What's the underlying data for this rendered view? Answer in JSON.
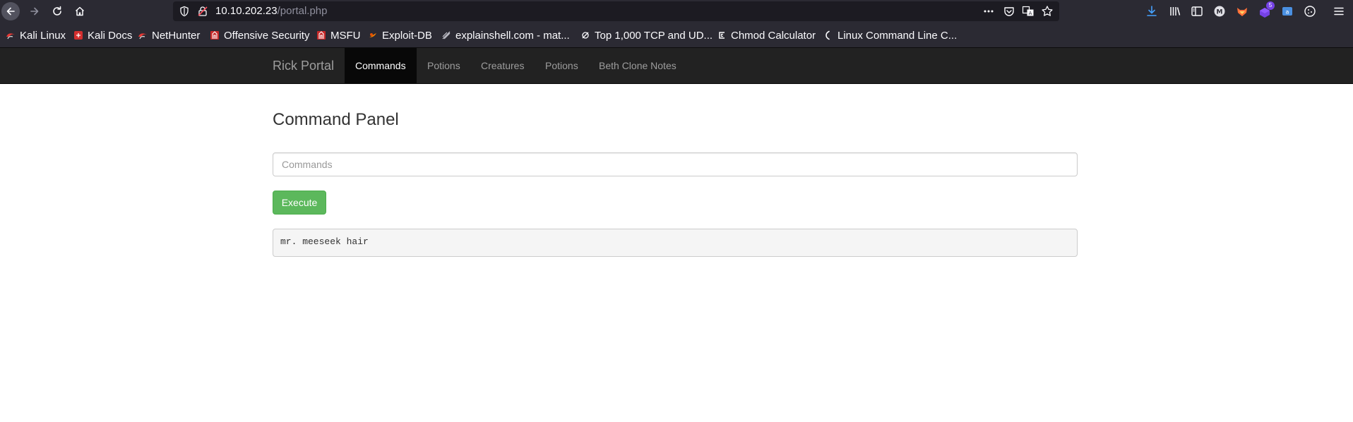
{
  "browser": {
    "url_host": "10.10.202.23",
    "url_path": "/portal.php",
    "extension_badge": "5"
  },
  "bookmarks": [
    {
      "label": "Kali Linux",
      "icon": "kali-icon"
    },
    {
      "label": "Kali Docs",
      "icon": "kali-docs-icon"
    },
    {
      "label": "NetHunter",
      "icon": "kali-icon"
    },
    {
      "label": "Offensive Security",
      "icon": "offsec-icon"
    },
    {
      "label": "MSFU",
      "icon": "offsec-icon"
    },
    {
      "label": "Exploit-DB",
      "icon": "exploit-db-icon"
    },
    {
      "label": "explainshell.com - mat...",
      "icon": "explainshell-icon"
    },
    {
      "label": "Top 1,000 TCP and UD...",
      "icon": "null-icon"
    },
    {
      "label": "Chmod Calculator",
      "icon": "chmod-icon"
    },
    {
      "label": "Linux Command Line C...",
      "icon": "bracket-icon"
    }
  ],
  "navbar": {
    "brand": "Rick Portal",
    "items": [
      {
        "label": "Commands",
        "active": true
      },
      {
        "label": "Potions",
        "active": false
      },
      {
        "label": "Creatures",
        "active": false
      },
      {
        "label": "Potions",
        "active": false
      },
      {
        "label": "Beth Clone Notes",
        "active": false
      }
    ]
  },
  "main": {
    "title": "Command Panel",
    "input_placeholder": "Commands",
    "input_value": "",
    "execute_label": "Execute",
    "output": "mr. meeseek hair"
  },
  "colors": {
    "navbar_bg": "#222222",
    "navbar_active_bg": "#080808",
    "execute_green": "#5cb85c",
    "browser_chrome": "#2b2a33"
  }
}
